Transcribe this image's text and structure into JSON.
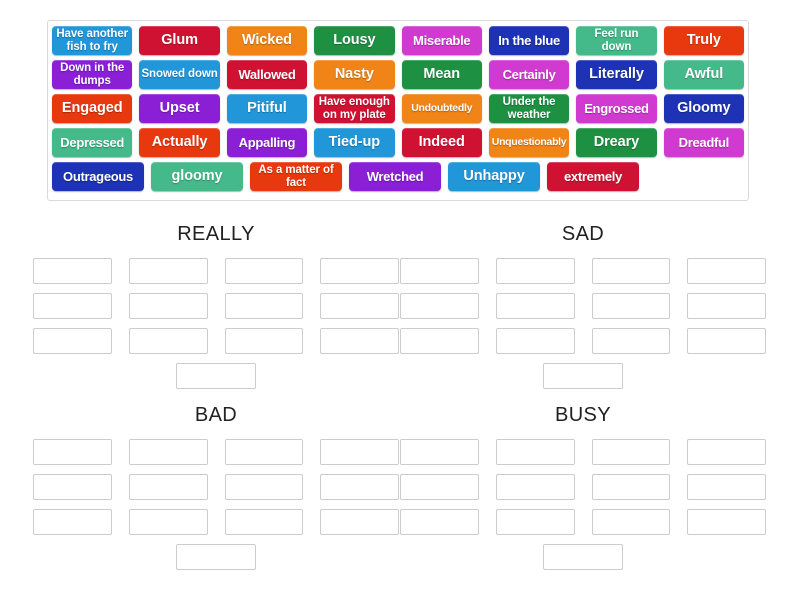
{
  "tile_bank": {
    "name": "word-tile-bank",
    "rows": [
      [
        {
          "label": "Have another fish to fry",
          "color": "#2196d8",
          "style": "two-line"
        },
        {
          "label": "Glum",
          "color": "#cf1232",
          "style": "normal"
        },
        {
          "label": "Wicked",
          "color": "#f08416",
          "style": "normal"
        },
        {
          "label": "Lousy",
          "color": "#1e9042",
          "style": "normal"
        },
        {
          "label": "Miserable",
          "color": "#d13ad1",
          "style": "mid"
        },
        {
          "label": "In the blue",
          "color": "#1d32b4",
          "style": "mid"
        },
        {
          "label": "Feel run down",
          "color": "#44b98a",
          "style": "two-line"
        },
        {
          "label": "Truly",
          "color": "#e8380d",
          "style": "normal"
        }
      ],
      [
        {
          "label": "Down in the dumps",
          "color": "#8a1fd6",
          "style": "two-line"
        },
        {
          "label": "Snowed down",
          "color": "#2196d8",
          "style": "two-line"
        },
        {
          "label": "Wallowed",
          "color": "#cf1232",
          "style": "mid"
        },
        {
          "label": "Nasty",
          "color": "#f08416",
          "style": "normal"
        },
        {
          "label": "Mean",
          "color": "#1e9042",
          "style": "normal"
        },
        {
          "label": "Certainly",
          "color": "#d13ad1",
          "style": "mid"
        },
        {
          "label": "Literally",
          "color": "#1d32b4",
          "style": "normal"
        },
        {
          "label": "Awful",
          "color": "#44b98a",
          "style": "normal"
        }
      ],
      [
        {
          "label": "Engaged",
          "color": "#e8380d",
          "style": "normal"
        },
        {
          "label": "Upset",
          "color": "#8a1fd6",
          "style": "normal"
        },
        {
          "label": "Pitiful",
          "color": "#2196d8",
          "style": "normal"
        },
        {
          "label": "Have enough on my plate",
          "color": "#cf1232",
          "style": "two-line"
        },
        {
          "label": "Undoubtedly",
          "color": "#f08416",
          "style": "small"
        },
        {
          "label": "Under the weather",
          "color": "#1e9042",
          "style": "two-line"
        },
        {
          "label": "Engrossed",
          "color": "#d13ad1",
          "style": "mid"
        },
        {
          "label": "Gloomy",
          "color": "#1d32b4",
          "style": "normal"
        }
      ],
      [
        {
          "label": "Depressed",
          "color": "#44b98a",
          "style": "mid"
        },
        {
          "label": "Actually",
          "color": "#e8380d",
          "style": "normal"
        },
        {
          "label": "Appalling",
          "color": "#8a1fd6",
          "style": "mid"
        },
        {
          "label": "Tied-up",
          "color": "#2196d8",
          "style": "normal"
        },
        {
          "label": "Indeed",
          "color": "#cf1232",
          "style": "normal"
        },
        {
          "label": "Unquestionably",
          "color": "#f08416",
          "style": "small"
        },
        {
          "label": "Dreary",
          "color": "#1e9042",
          "style": "normal"
        },
        {
          "label": "Dreadful",
          "color": "#d13ad1",
          "style": "mid"
        }
      ],
      [
        {
          "label": "Outrageous",
          "color": "#1d32b4",
          "style": "mid"
        },
        {
          "label": "gloomy",
          "color": "#44b98a",
          "style": "normal"
        },
        {
          "label": "As a matter of fact",
          "color": "#e8380d",
          "style": "two-line"
        },
        {
          "label": "Wretched",
          "color": "#8a1fd6",
          "style": "mid"
        },
        {
          "label": "Unhappy",
          "color": "#2196d8",
          "style": "normal"
        },
        {
          "label": "extremely",
          "color": "#cf1232",
          "style": "mid"
        }
      ]
    ]
  },
  "groups": [
    {
      "id": "really",
      "title": "REALLY",
      "rows": [
        4,
        4,
        4,
        1
      ]
    },
    {
      "id": "sad",
      "title": "SAD",
      "rows": [
        4,
        4,
        4,
        1
      ]
    },
    {
      "id": "bad",
      "title": "BAD",
      "rows": [
        4,
        4,
        4,
        1
      ]
    },
    {
      "id": "busy",
      "title": "BUSY",
      "rows": [
        4,
        4,
        4,
        1
      ]
    }
  ],
  "colors": {
    "slot_border": "#cccccc",
    "bank_border": "#d9d9d9",
    "title_text": "#222222",
    "background": "#ffffff"
  }
}
